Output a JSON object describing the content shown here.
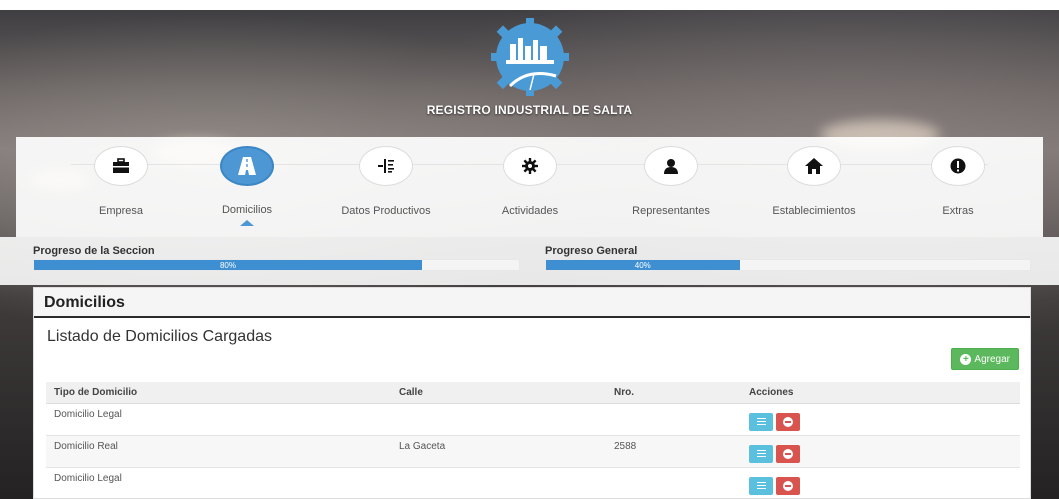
{
  "header": {
    "brand": "REGISTRO INDUSTRIAL DE SALTA",
    "logo_icon": "industrial-gear-logo"
  },
  "wizard": {
    "steps": [
      {
        "label": "Empresa",
        "icon": "briefcase-icon",
        "active": false
      },
      {
        "label": "Domicilios",
        "icon": "road-icon",
        "active": true
      },
      {
        "label": "Datos Productivos",
        "icon": "indent-icon",
        "active": false
      },
      {
        "label": "Actividades",
        "icon": "gear-icon",
        "active": false
      },
      {
        "label": "Representantes",
        "icon": "user-icon",
        "active": false
      },
      {
        "label": "Establecimientos",
        "icon": "home-icon",
        "active": false
      },
      {
        "label": "Extras",
        "icon": "exclamation-icon",
        "active": false
      }
    ]
  },
  "progress": {
    "section_label": "Progreso de la Seccion",
    "section_value": 0.8,
    "section_text": "80%",
    "general_label": "Progreso General",
    "general_value": 0.4,
    "general_text": "40%"
  },
  "panel": {
    "title": "Domicilios",
    "subtitle": "Listado de Domicilios Cargadas",
    "add_label": "Agregar",
    "columns": [
      "Tipo de Domicilio",
      "Calle",
      "Nro.",
      "Acciones"
    ],
    "rows": [
      {
        "tipo": "Domicilio Legal",
        "calle": "",
        "nro": ""
      },
      {
        "tipo": "Domicilio Real",
        "calle": "La Gaceta",
        "nro": "2588"
      },
      {
        "tipo": "Domicilio Legal",
        "calle": "",
        "nro": ""
      }
    ]
  },
  "colors": {
    "accent": "#4d98d4",
    "progress": "#3d8fd1",
    "success": "#5cb85c",
    "info": "#5bc0de",
    "danger": "#d9534f"
  }
}
